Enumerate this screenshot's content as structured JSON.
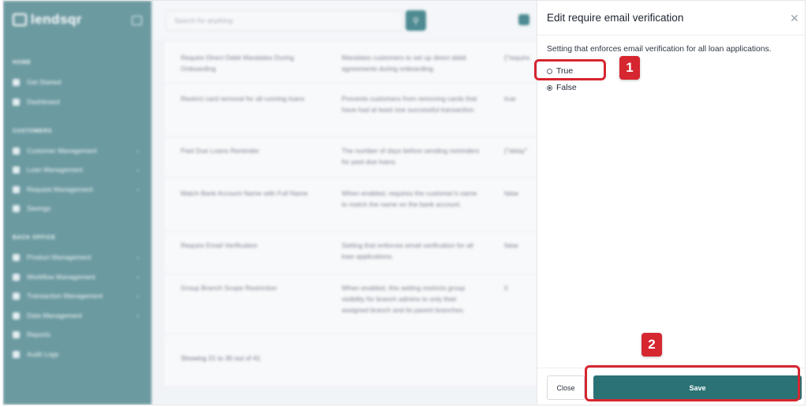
{
  "sidebar": {
    "logo_text": "lendsqr",
    "sections": [
      {
        "title": "HOME"
      },
      {
        "title": "CUSTOMERS"
      },
      {
        "title": "BACK OFFICE"
      }
    ],
    "items": [
      {
        "label": "Get Started",
        "chev": ""
      },
      {
        "label": "Dashboard",
        "chev": ""
      },
      {
        "label": "Customer Management",
        "chev": "›"
      },
      {
        "label": "Loan Management",
        "chev": "›"
      },
      {
        "label": "Request Management",
        "chev": "›"
      },
      {
        "label": "Savings",
        "chev": ""
      },
      {
        "label": "Product Management",
        "chev": "›"
      },
      {
        "label": "Workflow Management",
        "chev": "›"
      },
      {
        "label": "Transaction Management",
        "chev": "›"
      },
      {
        "label": "Data Management",
        "chev": "›"
      },
      {
        "label": "Reports",
        "chev": ""
      },
      {
        "label": "Audit Logs",
        "chev": ""
      }
    ]
  },
  "topbar": {
    "search_placeholder": "Search for anything"
  },
  "table": {
    "rows": [
      {
        "name": "Require Direct Debit Mandates During Onboarding",
        "description": "Mandates customers to set up direct debit agreements during onboarding.",
        "value": "{\"require"
      },
      {
        "name": "Restrict card removal for all running loans",
        "description": "Prevents customers from removing cards that have had at least one successful transaction.",
        "value": "true"
      },
      {
        "name": "Past Due Loans Reminder",
        "description": "The number of days before sending reminders for past due loans.",
        "value": "{\"delay\""
      },
      {
        "name": "Match Bank Account Name with Full Name",
        "description": "When enabled, requires the customer's name to match the name on the bank account.",
        "value": "false"
      },
      {
        "name": "Require Email Verification",
        "description": "Setting that enforces email verification for all loan applications.",
        "value": "false"
      },
      {
        "name": "Group Branch Scope Restriction",
        "description": "When enabled, this setting restricts group visibility for branch admins to only their assigned branch and its parent branches.",
        "value": "0"
      }
    ],
    "footer": "Showing 21 to 30 out of 41"
  },
  "drawer": {
    "title": "Edit require email verification",
    "description": "Setting that enforces email verification for all loan applications.",
    "options": [
      {
        "label": "True",
        "checked": false
      },
      {
        "label": "False",
        "checked": true
      }
    ],
    "close_label": "Close",
    "save_label": "Save"
  },
  "annotations": {
    "step1": "1",
    "step2": "2",
    "color": "#d62630"
  },
  "colors": {
    "sidebar": "#6c9aa1",
    "primary": "#2b7275"
  }
}
